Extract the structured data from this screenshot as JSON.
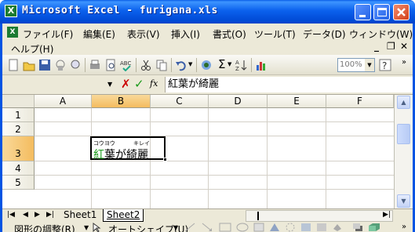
{
  "window": {
    "title": "Microsoft Excel - furigana.xls",
    "app_icon": "X"
  },
  "menu": {
    "items": [
      "ファイル(F)",
      "編集(E)",
      "表示(V)",
      "挿入(I)",
      "書式(O)",
      "ツール(T)",
      "データ(D)",
      "ウィンドウ(W)"
    ],
    "help": "ヘルプ(H)"
  },
  "toolbar": {
    "zoom": "100%"
  },
  "formula_bar": {
    "content": "紅葉が綺麗"
  },
  "grid": {
    "columns": [
      "A",
      "B",
      "C",
      "D",
      "E",
      "F"
    ],
    "rows": [
      "1",
      "2",
      "3",
      "4",
      "5"
    ],
    "selected_column": "B",
    "selected_row": "3",
    "active_cell": {
      "furigana_1": "コウヨウ",
      "furigana_2": "キレイ",
      "text_part1": "紅",
      "text_part2": "葉が綺麗"
    }
  },
  "sheets": {
    "tabs": [
      "Sheet1",
      "Sheet2"
    ],
    "active": "Sheet2"
  },
  "drawing_toolbar": {
    "draw_label": "図形の調整(R)",
    "autoshape_label": "オートシェイプ(U)"
  }
}
